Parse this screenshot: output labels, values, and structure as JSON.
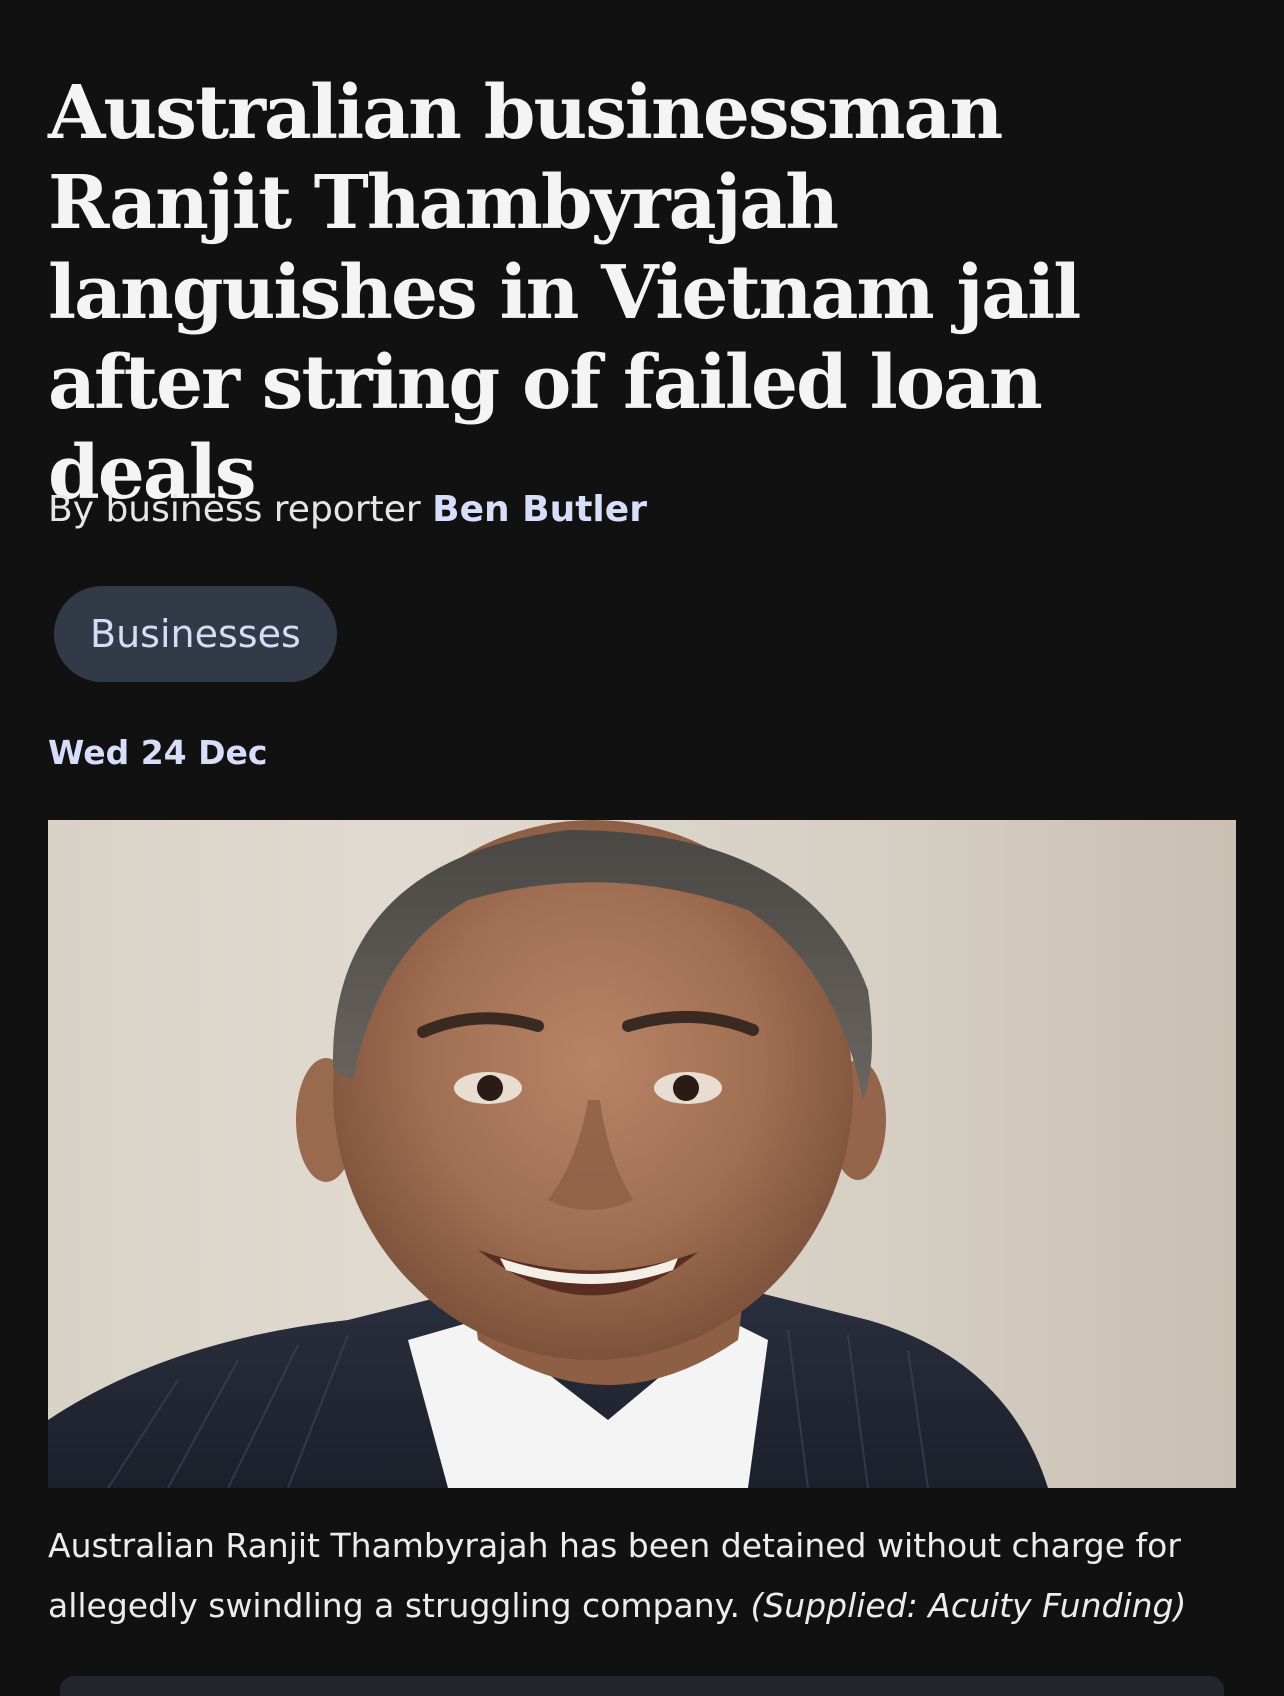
{
  "article": {
    "headline": "Australian businessman Ranjit Thambyrajah languishes in Vietnam jail after string of failed loan deals",
    "byline_prefix": "By business reporter ",
    "author": "Ben Butler",
    "tag": "Businesses",
    "date": "Wed 24 Dec",
    "caption_text": "Australian Ranjit Thambyrajah has been detained without charge for allegedly swindling a struggling company.",
    "caption_credit": "(Supplied: Acuity Funding)"
  },
  "colors": {
    "background": "#111112",
    "accent_link": "#d6defa",
    "tag_background": "#323a48"
  }
}
